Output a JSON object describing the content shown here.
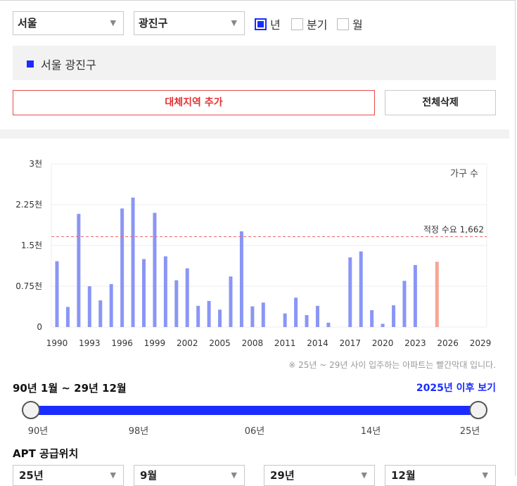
{
  "filters": {
    "city": "서울",
    "district": "광진구",
    "periods": [
      {
        "label": "년",
        "checked": true
      },
      {
        "label": "분기",
        "checked": false
      },
      {
        "label": "월",
        "checked": false
      }
    ]
  },
  "region_tag": "서울 광진구",
  "buttons": {
    "add_region": "대체지역 추가",
    "delete_all": "전체삭제"
  },
  "chart_data": {
    "type": "bar",
    "legend_label": "가구 수",
    "y_ticks": [
      "3천",
      "2.25천",
      "1.5천",
      "0.75천",
      "0"
    ],
    "ylim": [
      0,
      3000
    ],
    "x_ticks": [
      "1990",
      "1993",
      "1996",
      "1999",
      "2002",
      "2005",
      "2008",
      "2011",
      "2014",
      "2017",
      "2020",
      "2023",
      "2026",
      "2029"
    ],
    "x_range": [
      1990,
      2029
    ],
    "reference_line": {
      "label": "적정 수요 1,662",
      "value": 1662
    },
    "years": [
      1990,
      1991,
      1992,
      1993,
      1994,
      1995,
      1996,
      1997,
      1998,
      1999,
      2000,
      2001,
      2002,
      2003,
      2004,
      2005,
      2006,
      2007,
      2008,
      2009,
      2010,
      2011,
      2012,
      2013,
      2014,
      2015,
      2016,
      2017,
      2018,
      2019,
      2020,
      2021,
      2022,
      2023,
      2024,
      2025
    ],
    "values": [
      1210,
      370,
      2080,
      750,
      490,
      790,
      2180,
      2380,
      1250,
      2100,
      1300,
      860,
      1080,
      390,
      480,
      320,
      930,
      1760,
      380,
      450,
      0,
      250,
      540,
      220,
      390,
      80,
      0,
      1280,
      1390,
      310,
      60,
      400,
      850,
      1140,
      0,
      1200
    ],
    "highlight_years": [
      2025
    ],
    "colors": {
      "bar": "#8a96f5",
      "highlight": "#f7a595",
      "reference": "#e86a6a"
    }
  },
  "note": "※ 25년 ~ 29년 사이 입주하는 아파트는 빨간막대 입니다.",
  "range": {
    "label": "90년 1월 ~ 29년 12월",
    "after_link": "2025년 이후 보기",
    "ticks": [
      "90년",
      "98년",
      "06년",
      "14년",
      "25년"
    ],
    "start_fraction": 0,
    "end_fraction": 1
  },
  "apt_section": {
    "title": "APT 공급위치",
    "selects": [
      "25년",
      "9월",
      "29년",
      "12월"
    ]
  }
}
